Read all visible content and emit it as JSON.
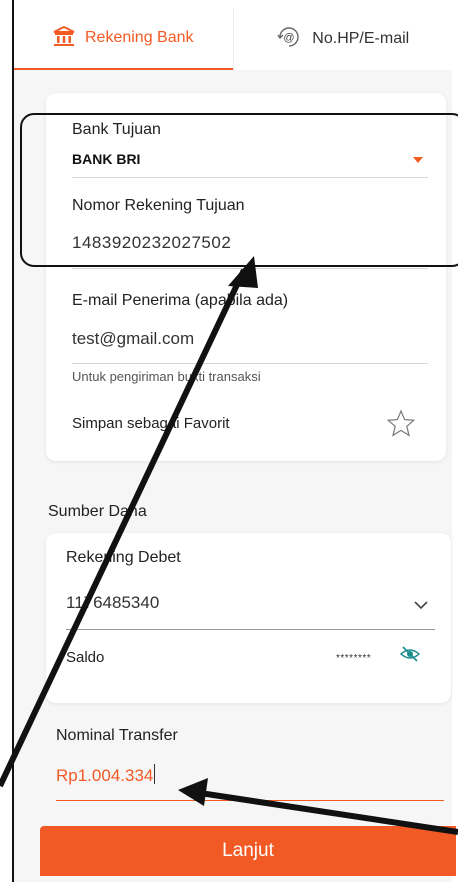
{
  "tabs": [
    {
      "label": "Rekening Bank",
      "icon": "bank-icon",
      "active": true
    },
    {
      "label": "No.HP/E-mail",
      "icon": "at-phone-icon",
      "active": false
    }
  ],
  "form": {
    "bank_label": "Bank Tujuan",
    "bank_value": "BANK BRI",
    "account_label": "Nomor Rekening Tujuan",
    "account_value": "1483920232027502",
    "email_label": "E-mail Penerima (apabila ada)",
    "email_value": "test@gmail.com",
    "email_helper": "Untuk pengiriman bukti transaksi",
    "favorite_label": "Simpan sebagai Favorit"
  },
  "source": {
    "section_title": "Sumber Dana",
    "debit_label": "Rekening Debet",
    "debit_value": "1176485340",
    "balance_label": "Saldo",
    "balance_value": "********"
  },
  "transfer": {
    "nominal_label": "Nominal Transfer",
    "nominal_value": "Rp1.004.334"
  },
  "actions": {
    "continue_label": "Lanjut"
  },
  "colors": {
    "accent": "#f15a24",
    "annotation": "#111111"
  }
}
